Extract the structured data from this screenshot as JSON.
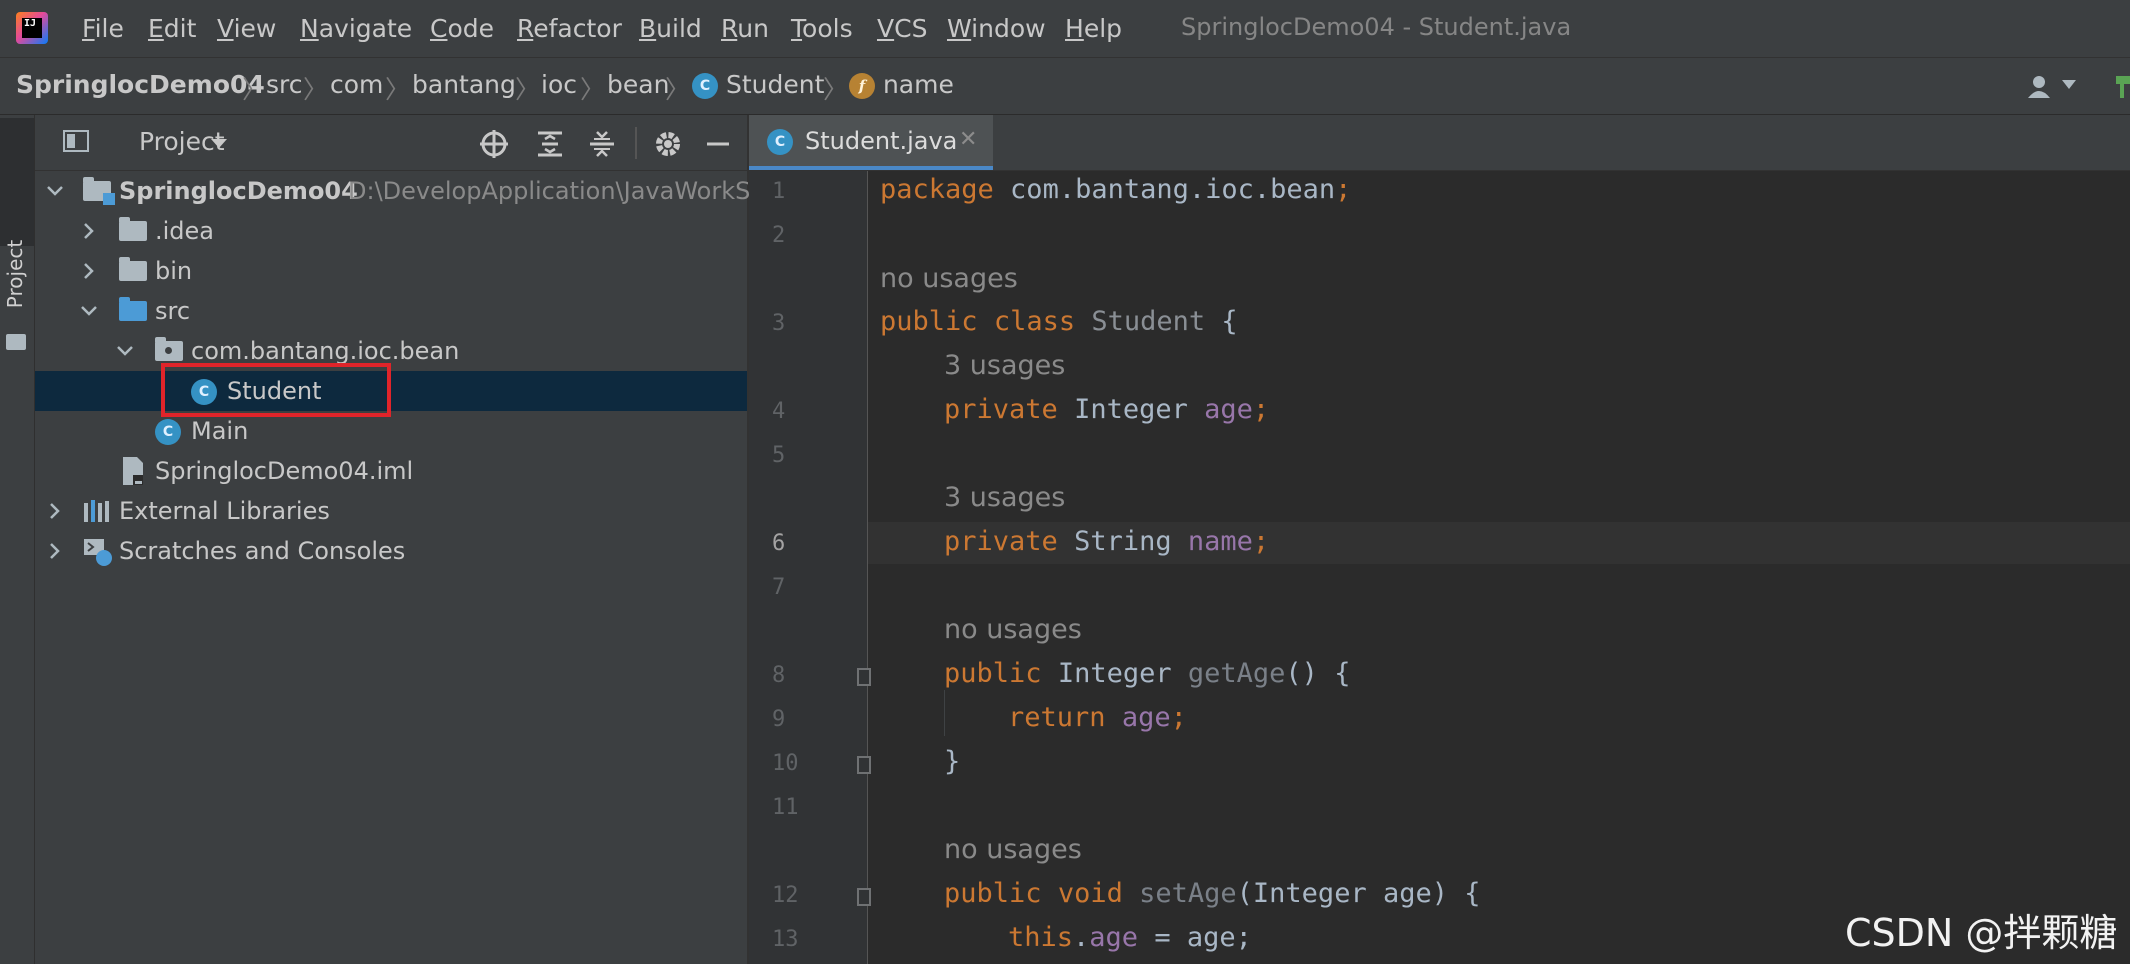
{
  "app": {
    "logo_text": "IJ",
    "window_title": "SpringlocDemo04 - Student.java"
  },
  "menu": [
    "File",
    "Edit",
    "View",
    "Navigate",
    "Code",
    "Refactor",
    "Build",
    "Run",
    "Tools",
    "VCS",
    "Window",
    "Help"
  ],
  "breadcrumb": {
    "project": "SpringlocDemo04",
    "src": "src",
    "com": "com",
    "bantang": "bantang",
    "ioc": "ioc",
    "bean": "bean",
    "class_name": "Student",
    "field_name": "name",
    "class_icon": "c-icon",
    "field_icon": "f-icon"
  },
  "sidebar_stripe": {
    "label": "Project"
  },
  "project_panel": {
    "title": "Project",
    "tree": [
      {
        "label": "SpringlocDemo04",
        "path": "D:\\DevelopApplication\\JavaWorkSp",
        "icon": "module-folder-icon"
      },
      {
        "label": ".idea",
        "icon": "folder-icon"
      },
      {
        "label": "bin",
        "icon": "folder-icon"
      },
      {
        "label": "src",
        "icon": "source-folder-icon"
      },
      {
        "label": "com.bantang.ioc.bean",
        "icon": "package-icon"
      },
      {
        "label": "Student",
        "icon": "class-icon"
      },
      {
        "label": "Main",
        "icon": "class-icon"
      },
      {
        "label": "SpringlocDemo04.iml",
        "icon": "iml-file-icon"
      },
      {
        "label": "External Libraries",
        "icon": "libraries-icon"
      },
      {
        "label": "Scratches and Consoles",
        "icon": "scratches-icon"
      }
    ]
  },
  "editor": {
    "tab_label": "Student.java",
    "line_numbers": [
      "1",
      "2",
      "3",
      "4",
      "5",
      "6",
      "7",
      "8",
      "9",
      "10",
      "11",
      "12",
      "13"
    ],
    "hints": {
      "no_usages": "no usages",
      "three_usages": "3 usages"
    },
    "tokens": {
      "package": "package",
      "package_name": " com.bantang.ioc.bean",
      "semi": ";",
      "public": "public",
      "class": "class",
      "student": "Student",
      "brace_open": " {",
      "private": "private",
      "integer": "Integer",
      "string": "String",
      "age": "age",
      "name": "name",
      "getAge": "getAge",
      "parens_open": "() {",
      "return": "return",
      "close_brace": "}",
      "void": "void",
      "setAge": "setAge",
      "param": "(Integer age) {",
      "this": "this",
      "dot": ".",
      "assign": " = age;"
    }
  },
  "watermark": "CSDN @拌颗糖"
}
